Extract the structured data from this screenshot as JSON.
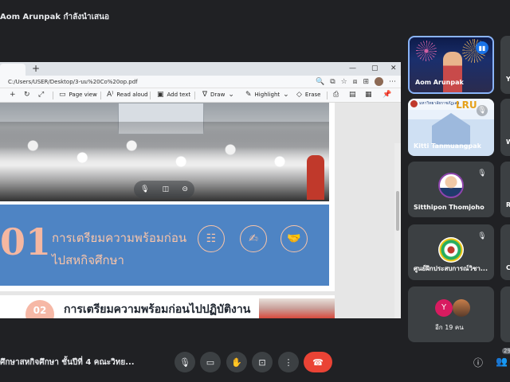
{
  "presenter": {
    "title": "Aom Arunpak กำลังนำเสนอ"
  },
  "browser": {
    "new_tab": "+",
    "min": "—",
    "max": "▢",
    "address": "C:/Users/USER/Desktop/3-บม%20Co%20op.pdf"
  },
  "pdf_toolbar": {
    "add_label": "+",
    "page_view": "Page view",
    "read_aloud": "Read aloud",
    "add_text": "Add text",
    "draw": "Draw",
    "highlight": "Highlight",
    "erase": "Erase"
  },
  "slide1": {
    "number": "01",
    "line1": "การเตรียมความพร้อมก่อน",
    "line2": "ไปสหกิจศึกษา"
  },
  "slide2": {
    "number": "02",
    "heading": "การเตรียมความพร้อมก่อนไปปฏิบัติงาน"
  },
  "participants": {
    "aom": "Aom Arunpak",
    "kitti": "Kitti Tanmuangpak",
    "kitti_uni": "มหาวิทยาลัยราชภัฏเลย",
    "kitti_lru": "LRU",
    "sitthipon": "Sitthipon Thomjoho",
    "center": "ศูนย์ฝึกประสบการณ์วิชา...",
    "more_initial": "Y",
    "more": "อีก 19 คน",
    "edge": [
      "Y",
      "W",
      "R",
      "C"
    ]
  },
  "bottom": {
    "meeting_name": "ศึกษาสหกิจศึกษา ชั้นปีที่ 4 คณะวิทย...",
    "people_count": "29"
  },
  "colors": {
    "meet_bg": "#202124",
    "tile_bg": "#3c4043",
    "slide_blue": "#4e84c4",
    "slide_peach": "#f9c4a8",
    "end_call": "#ea4335",
    "speaking": "#1a73e8"
  },
  "icons": [
    "microphone-icon",
    "camera-icon",
    "raise-hand-icon",
    "present-screen-icon",
    "more-options-icon",
    "end-call-icon",
    "info-icon",
    "people-icon",
    "mic-off-icon",
    "speaking-icon"
  ]
}
